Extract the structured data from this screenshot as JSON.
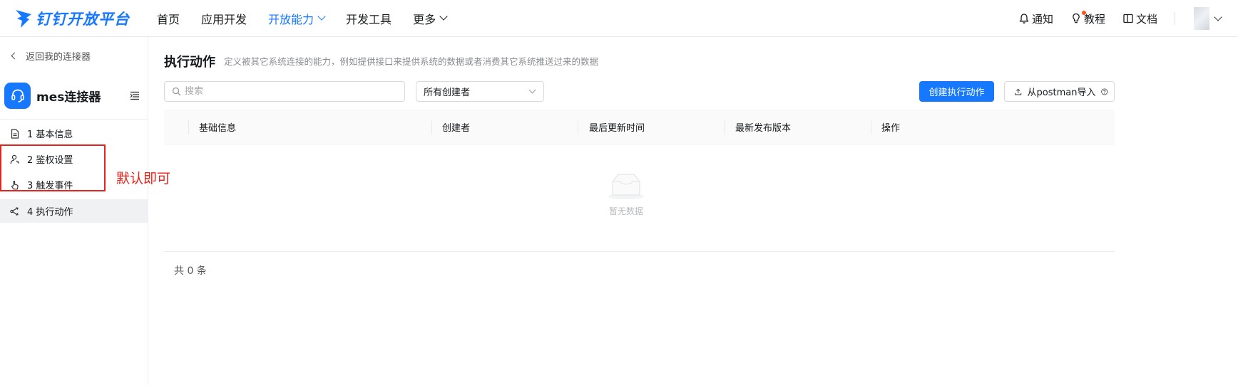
{
  "brand": {
    "name": "钉钉开放平台",
    "color": "#1677ff"
  },
  "nav": {
    "items": [
      {
        "label": "首页"
      },
      {
        "label": "应用开发"
      },
      {
        "label": "开放能力",
        "active": true
      },
      {
        "label": "开发工具"
      },
      {
        "label": "更多"
      }
    ],
    "right": {
      "notify": "通知",
      "tutorial": "教程",
      "docs": "文档"
    }
  },
  "sidebar": {
    "back_label": "返回我的连接器",
    "connector_name": "mes连接器",
    "steps": [
      {
        "label": "1 基本信息"
      },
      {
        "label": "2 鉴权设置"
      },
      {
        "label": "3 触发事件"
      },
      {
        "label": "4 执行动作",
        "active": true
      }
    ]
  },
  "annotation": {
    "text": "默认即可",
    "color": "#e8231b"
  },
  "main": {
    "title": "执行动作",
    "description": "定义被其它系统连接的能力，例如提供接口来提供系统的数据或者消费其它系统推送过来的数据",
    "search_placeholder": "搜索",
    "creator_filter": "所有创建者",
    "create_button": "创建执行动作",
    "import_button": "从postman导入",
    "columns": [
      "基础信息",
      "创建者",
      "最后更新时间",
      "最新发布版本",
      "操作"
    ],
    "empty_text": "暂无数据",
    "total_text": "共 0 条"
  }
}
